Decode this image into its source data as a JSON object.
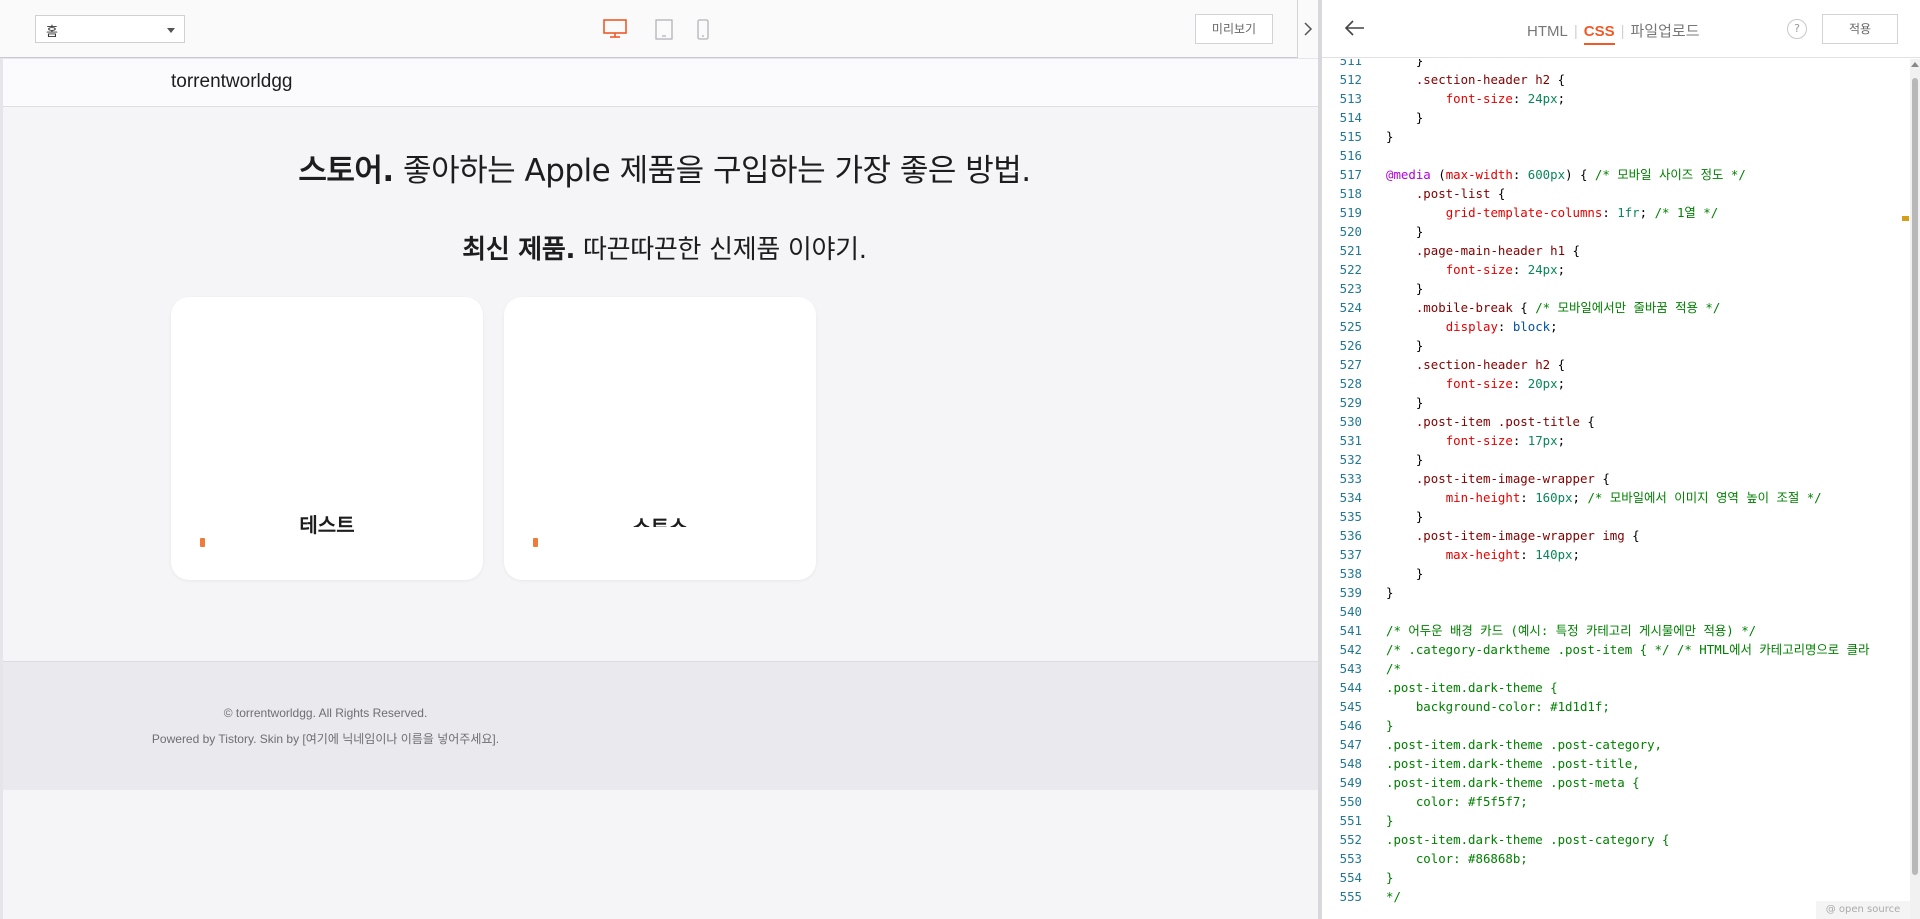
{
  "toolbar": {
    "page_select_value": "홈",
    "device_icons": [
      "desktop-icon",
      "tablet-icon",
      "mobile-icon"
    ],
    "preview_label": "미리보기",
    "accent_color": "#ef5a28"
  },
  "preview": {
    "site_name": "torrentworldgg",
    "headline_bold": "스토어.",
    "headline_rest": " 좋아하는 Apple 제품을 구입하는 가장 좋은 방법.",
    "subheadline_bold": "최신 제품.",
    "subheadline_rest": " 따끈따끈한 신제품 이야기.",
    "cards": [
      {
        "title": "테스트"
      },
      {
        "title": "스토스"
      }
    ],
    "footer_copy": "© torrentworldgg. All Rights Reserved.",
    "footer_powered": "Powered by Tistory. Skin by [여기에 닉네임이나 이름을 넣어주세요]."
  },
  "editor": {
    "tabs": [
      "HTML",
      "CSS",
      "파일업로드"
    ],
    "active_tab": "CSS",
    "help_label": "?",
    "apply_label": "적용",
    "open_source_label": "@ open source",
    "code_lines": [
      {
        "n": "511",
        "html": "    }"
      },
      {
        "n": "512",
        "html": "    <span class=\"sel\">.section-header h2</span> {"
      },
      {
        "n": "513",
        "html": "        <span class=\"prop\">font-size</span>: <span class=\"num\">24px</span>;"
      },
      {
        "n": "514",
        "html": "    }"
      },
      {
        "n": "515",
        "html": "}"
      },
      {
        "n": "516",
        "html": ""
      },
      {
        "n": "517",
        "html": "<span class=\"at\">@media</span> (<span class=\"prop\">max-width</span>: <span class=\"num\">600px</span>) { <span class=\"cmt\">/* 모바일 사이즈 정도 */</span>"
      },
      {
        "n": "518",
        "html": "    <span class=\"sel\">.post-list</span> {"
      },
      {
        "n": "519",
        "html": "        <span class=\"prop\">grid-template-columns</span>: <span class=\"num\">1fr</span>; <span class=\"cmt\">/* 1열 */</span>"
      },
      {
        "n": "520",
        "html": "    }"
      },
      {
        "n": "521",
        "html": "    <span class=\"sel\">.page-main-header h1</span> {"
      },
      {
        "n": "522",
        "html": "        <span class=\"prop\">font-size</span>: <span class=\"num\">24px</span>;"
      },
      {
        "n": "523",
        "html": "    }"
      },
      {
        "n": "524",
        "html": "    <span class=\"sel\">.mobile-break</span> { <span class=\"cmt\">/* 모바일에서만 줄바꿈 적용 */</span>"
      },
      {
        "n": "525",
        "html": "        <span class=\"prop\">display</span>: <span class=\"kw\">block</span>;"
      },
      {
        "n": "526",
        "html": "    }"
      },
      {
        "n": "527",
        "html": "    <span class=\"sel\">.section-header h2</span> {"
      },
      {
        "n": "528",
        "html": "        <span class=\"prop\">font-size</span>: <span class=\"num\">20px</span>;"
      },
      {
        "n": "529",
        "html": "    }"
      },
      {
        "n": "530",
        "html": "    <span class=\"sel\">.post-item .post-title</span> {"
      },
      {
        "n": "531",
        "html": "        <span class=\"prop\">font-size</span>: <span class=\"num\">17px</span>;"
      },
      {
        "n": "532",
        "html": "    }"
      },
      {
        "n": "533",
        "html": "    <span class=\"sel\">.post-item-image-wrapper</span> {"
      },
      {
        "n": "534",
        "html": "        <span class=\"prop\">min-height</span>: <span class=\"num\">160px</span>; <span class=\"cmt\">/* 모바일에서 이미지 영역 높이 조절 */</span>"
      },
      {
        "n": "535",
        "html": "    }"
      },
      {
        "n": "536",
        "html": "    <span class=\"sel\">.post-item-image-wrapper img</span> {"
      },
      {
        "n": "537",
        "html": "        <span class=\"prop\">max-height</span>: <span class=\"num\">140px</span>;"
      },
      {
        "n": "538",
        "html": "    }"
      },
      {
        "n": "539",
        "html": "}"
      },
      {
        "n": "540",
        "html": ""
      },
      {
        "n": "541",
        "html": "<span class=\"cmt\">/* 어두운 배경 카드 (예시: 특정 카테고리 게시물에만 적용) */</span>"
      },
      {
        "n": "542",
        "html": "<span class=\"cmt\">/* .category-darktheme .post-item { */ /* HTML에서 카테고리명으로 클라</span>"
      },
      {
        "n": "543",
        "html": "<span class=\"cmt\">/*</span>"
      },
      {
        "n": "544",
        "html": "<span class=\"cmt\">.post-item.dark-theme {</span>"
      },
      {
        "n": "545",
        "html": "<span class=\"cmt\">    background-color: #1d1d1f;</span>"
      },
      {
        "n": "546",
        "html": "<span class=\"cmt\">}</span>"
      },
      {
        "n": "547",
        "html": "<span class=\"cmt\">.post-item.dark-theme .post-category,</span>"
      },
      {
        "n": "548",
        "html": "<span class=\"cmt\">.post-item.dark-theme .post-title,</span>"
      },
      {
        "n": "549",
        "html": "<span class=\"cmt\">.post-item.dark-theme .post-meta {</span>"
      },
      {
        "n": "550",
        "html": "<span class=\"cmt\">    color: #f5f5f7;</span>"
      },
      {
        "n": "551",
        "html": "<span class=\"cmt\">}</span>"
      },
      {
        "n": "552",
        "html": "<span class=\"cmt\">.post-item.dark-theme .post-category {</span>"
      },
      {
        "n": "553",
        "html": "<span class=\"cmt\">    color: #86868b;</span>"
      },
      {
        "n": "554",
        "html": "<span class=\"cmt\">}</span>"
      },
      {
        "n": "555",
        "html": "<span class=\"cmt\">*/</span>"
      }
    ]
  }
}
